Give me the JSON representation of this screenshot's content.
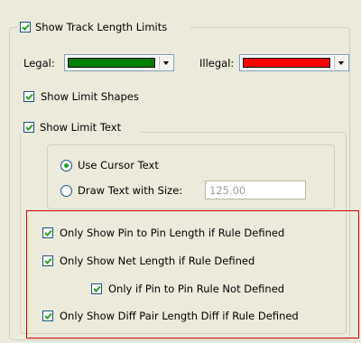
{
  "track_length": {
    "show_limits_label": "Show Track Length Limits",
    "show_limits_checked": true,
    "legal_label": "Legal:",
    "legal_color": "#008000",
    "illegal_label": "Illegal:",
    "illegal_color": "#ff0000",
    "show_limit_shapes_label": "Show Limit Shapes",
    "show_limit_shapes_checked": true,
    "show_limit_text_label": "Show Limit Text",
    "show_limit_text_checked": true,
    "use_cursor_text_label": "Use Cursor Text",
    "use_cursor_text_selected": true,
    "draw_text_with_size_label": "Draw Text with Size:",
    "text_size_value": "125.00"
  },
  "rules": {
    "pin_to_pin_label": "Only Show Pin to Pin Length if Rule Defined",
    "pin_to_pin_checked": true,
    "net_length_label": "Only Show Net Length if Rule Defined",
    "net_length_checked": true,
    "pin_rule_not_defined_label": "Only if Pin to Pin Rule Not Defined",
    "pin_rule_not_defined_checked": true,
    "diff_pair_label": "Only Show Diff Pair Length Diff if Rule Defined",
    "diff_pair_checked": true
  },
  "colors": {
    "dialog_bg": "#ebeadb",
    "checkbox_border": "#1c5180",
    "check_mark": "#21a121",
    "highlight_border": "#d40000"
  }
}
